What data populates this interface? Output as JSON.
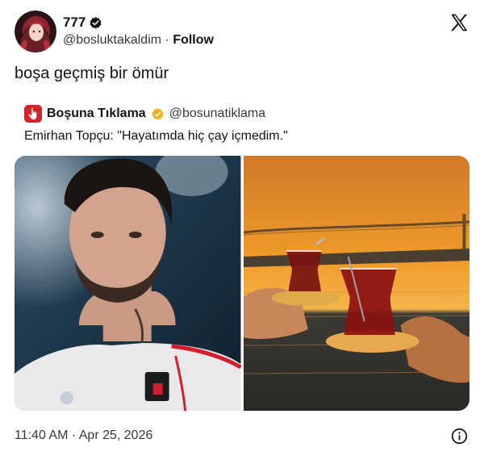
{
  "author": {
    "display_name": "777",
    "handle": "@bosluktakaldim",
    "separator": "·",
    "follow_label": "Follow",
    "avatar_icon": "anime-girl-avatar",
    "verified_icon": "verified-badge-icon"
  },
  "tweet": {
    "text": "boşa geçmiş bir ömür",
    "timestamp": "11:40 AM · Apr 25, 2026"
  },
  "quote": {
    "display_name": "Boşuna Tıklama",
    "handle": "@bosunatiklama",
    "text": "Emirhan Topçu: \"Hayatımda hiç çay içmedim.\"",
    "badge_color": "#e8b21c",
    "avatar_color": "#d6232a"
  },
  "media": {
    "left_image": "football-player-portrait",
    "right_image": "turkish-tea-bosphorus-sunset"
  },
  "colors": {
    "text_primary": "#0f1419",
    "text_secondary": "#36393d",
    "verified_blue": "#000000"
  }
}
